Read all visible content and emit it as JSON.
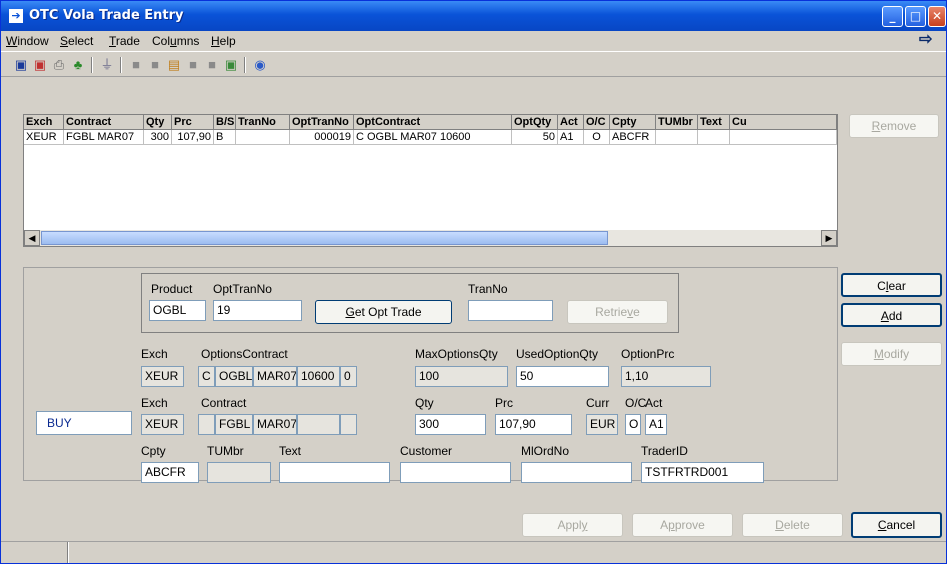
{
  "window": {
    "title": "OTC Vola Trade Entry",
    "app_icon": "arrow-right-icon",
    "minimize": "_",
    "maximize": "□",
    "close": "✕"
  },
  "menu": [
    "Window",
    "Select",
    "Trade",
    "Columns",
    "Help"
  ],
  "toolbar_icons": [
    "save-icon",
    "save-all-icon",
    "print-icon",
    "export-icon",
    "filter-icon",
    "grid-icon-1",
    "grid-icon-2",
    "grid-icon-3",
    "grid-icon-4",
    "grid-icon-5",
    "grid-icon-6",
    "help-icon"
  ],
  "grid": {
    "columns": [
      "Exch",
      "Contract",
      "Qty",
      "Prc",
      "B/S",
      "TranNo",
      "OptTranNo",
      "OptContract",
      "OptQty",
      "Act",
      "O/C",
      "Cpty",
      "TUMbr",
      "Text",
      "Cu"
    ],
    "rows": [
      [
        "XEUR",
        "FGBL MAR07",
        "300",
        "107,90",
        "B",
        "",
        "000019",
        "C OGBL MAR07 10600",
        "50",
        "A1",
        "O",
        "ABCFR",
        "",
        "",
        ""
      ]
    ]
  },
  "buttons": {
    "remove": "Remove",
    "clear": "Clear",
    "add": "Add",
    "modify": "Modify",
    "get_opt_trade": "Get Opt Trade",
    "retrieve": "Retrieve",
    "apply": "Apply",
    "approve": "Approve",
    "delete": "Delete",
    "cancel": "Cancel",
    "buy": "BUY"
  },
  "form": {
    "lbl_product": "Product",
    "lbl_opttranno": "OptTranNo",
    "lbl_tranno": "TranNo",
    "product": "OGBL",
    "opttranno": "19",
    "tranno": "",
    "lbl_exch": "Exch",
    "lbl_options_contract": "OptionsContract",
    "lbl_maxoptionsqty": "MaxOptionsQty",
    "lbl_usedoptionqty": "UsedOptionQty",
    "lbl_optionprc": "OptionPrc",
    "opt_exch": "XEUR",
    "opt_cp": "C",
    "opt_product": "OGBL",
    "opt_month": "MAR07",
    "opt_strike": "10600",
    "opt_version": "0",
    "maxoptionsqty": "100",
    "usedoptionqty": "50",
    "optionprc": "1,10",
    "lbl_exch2": "Exch",
    "lbl_contract": "Contract",
    "lbl_qty": "Qty",
    "lbl_prc": "Prc",
    "lbl_curr": "Curr",
    "lbl_oc": "O/C",
    "lbl_act": "Act",
    "fut_exch": "XEUR",
    "fut_flag": "",
    "fut_product": "FGBL",
    "fut_month": "MAR07",
    "fut_extra1": "",
    "fut_extra2": "",
    "qty": "300",
    "prc": "107,90",
    "curr": "EUR",
    "oc": "O",
    "act": "A1",
    "lbl_cpty": "Cpty",
    "lbl_tumbr": "TUMbr",
    "lbl_text": "Text",
    "lbl_customer": "Customer",
    "lbl_mlordno": "MlOrdNo",
    "lbl_traderid": "TraderID",
    "cpty": "ABCFR",
    "tumbr": "",
    "text": "",
    "customer": "",
    "mlordno": "",
    "traderid": "TSTFRTRD001"
  }
}
